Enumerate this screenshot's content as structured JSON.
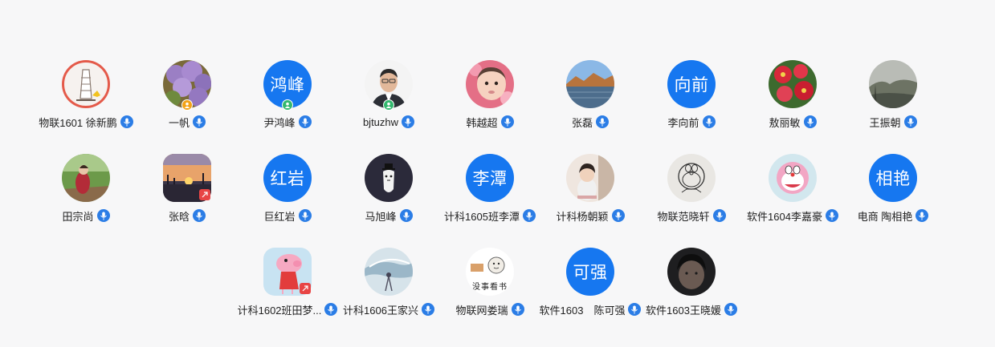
{
  "colors": {
    "avatar_blue": "#1677f0",
    "mic_blue": "#2b7de6",
    "badge_green": "#32b86e",
    "badge_orange": "#f3a317",
    "badge_red": "#e84545"
  },
  "participants": [
    {
      "name": "物联1601 徐新鹏",
      "avatar": "tower-photo"
    },
    {
      "name": "一帆",
      "avatar": "wisteria-photo",
      "role_badge": "orange"
    },
    {
      "name": "尹鸿峰",
      "avatar_text": "鸿峰",
      "role_badge": "green"
    },
    {
      "name": "bjtuzhw",
      "avatar": "man-photo",
      "role_badge": "green"
    },
    {
      "name": "韩越超",
      "avatar": "baby-photo"
    },
    {
      "name": "张磊",
      "avatar": "lake-photo"
    },
    {
      "name": "李向前",
      "avatar_text": "向前"
    },
    {
      "name": "敖丽敏",
      "avatar": "flowers-photo"
    },
    {
      "name": "王振朝",
      "avatar": "hills-photo"
    },
    {
      "name": "田宗尚",
      "avatar": "garden-photo"
    },
    {
      "name": "张晗",
      "avatar": "sunset-photo",
      "red_badge": true
    },
    {
      "name": "巨红岩",
      "avatar_text": "红岩"
    },
    {
      "name": "马旭峰",
      "avatar": "cat-drawing"
    },
    {
      "name": "计科1605班李潭",
      "avatar_text": "李潭"
    },
    {
      "name": "计科杨朝颖",
      "avatar": "girl-photo"
    },
    {
      "name": "物联范晓轩",
      "avatar": "doraemon-sketch"
    },
    {
      "name": "软件1604李嘉豪",
      "avatar": "doraemon-cartoon"
    },
    {
      "name": "电商 陶相艳",
      "avatar_text": "相艳"
    },
    {
      "name": "计科1602班田梦...",
      "avatar": "peppa-cartoon",
      "square": true,
      "red_badge": true
    },
    {
      "name": "计科1606王家兴",
      "avatar": "anime-whale"
    },
    {
      "name": "物联网娄瑞",
      "avatar": "text-sticker",
      "sticker_text": "没事看书"
    },
    {
      "name": "软件1603　陈可强",
      "avatar_text": "可强"
    },
    {
      "name": "软件1603王晓媛",
      "avatar": "dark-portrait"
    }
  ]
}
